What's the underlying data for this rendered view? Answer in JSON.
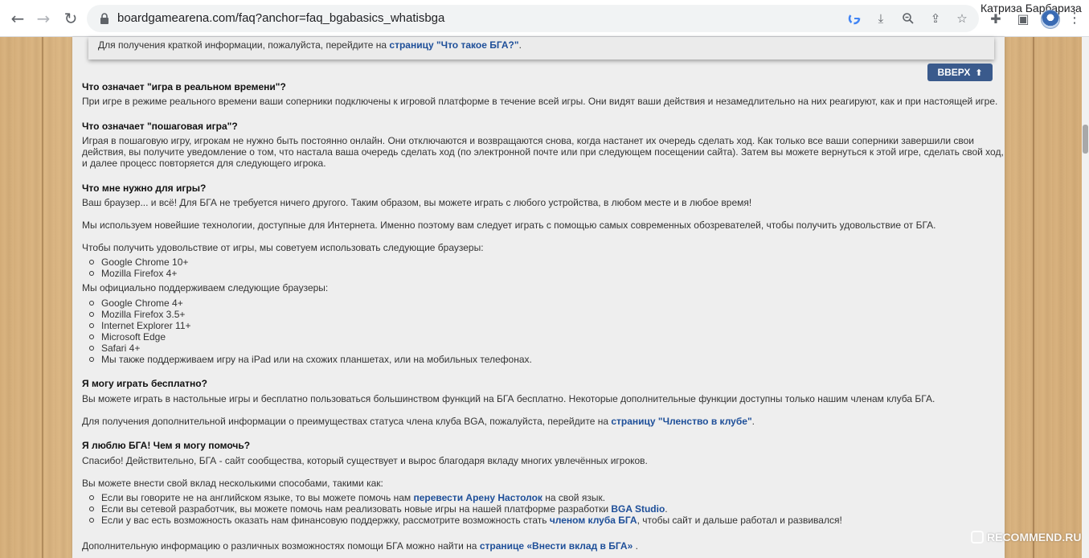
{
  "browser": {
    "url": "boardgamearena.com/faq?anchor=faq_bgabasics_whatisbga",
    "profile_name": "Катриза Барбариза"
  },
  "info": {
    "text": "Для получения краткой информации, пожалуйста, перейдите на ",
    "link": "страницу \"Что такое БГА?\"",
    "tail": "."
  },
  "top_button": "ВВЕРХ",
  "faq": {
    "q1": "Что означает \"игра в реальном времени\"?",
    "a1": "При игре в режиме реального времени ваши соперники подключены к игровой платформе в течение всей игры. Они видят ваши действия и незамедлительно на них реагируют, как и при настоящей игре.",
    "q2": "Что означает \"пошаговая игра\"?",
    "a2_l1": "Играя в пошаговую игру, игрокам не нужно быть постоянно онлайн. Они отключаются и возвращаются снова, когда настанет их очередь сделать ход. Как только все ваши соперники завершили свои",
    "a2_l2": "действия, вы получите уведомление о том, что настала ваша очередь сделать ход (по электронной почте или при следующем посещении сайта). Затем вы можете вернуться к этой игре, сделать свой ход,",
    "a2_l3": "и далее процесс повторяется для следующего игрока.",
    "q3": "Что мне нужно для игры?",
    "a3_p1": "Ваш браузер... и всё! Для БГА не требуется ничего другого. Таким образом, вы можете играть с любого устройства, в любом месте и в любое время!",
    "a3_p2": "Мы используем новейшие технологии, доступные для Интернета. Именно поэтому вам следует играть с помощью самых современных обозревателей, чтобы получить удовольствие от БГА.",
    "a3_p3": "Чтобы получить удовольствие от игры, мы советуем использовать следующие браузеры:",
    "recommended": [
      "Google Chrome 10+",
      "Mozilla Firefox 4+"
    ],
    "a3_p4": "Мы официально поддерживаем следующие браузеры:",
    "supported": [
      "Google Chrome 4+",
      "Mozilla Firefox 3.5+",
      "Internet Explorer 11+",
      "Microsoft Edge",
      "Safari 4+",
      "Мы также поддерживаем игру на iPad или на схожих планшетах, или на мобильных телефонах."
    ],
    "q4": "Я могу играть бесплатно?",
    "a4_p1": "Вы можете играть в настольные игры и бесплатно пользоваться большинством функций на БГА бесплатно. Некоторые дополнительные функции доступны только нашим членам клуба БГА.",
    "a4_p2_text": "Для получения дополнительной информации о преимуществах статуса члена клуба BGA, пожалуйста, перейдите на ",
    "a4_p2_link": "страницу \"Членство в клубе\"",
    "a4_p2_tail": ".",
    "q5": "Я люблю БГА! Чем я могу помочь?",
    "a5_p1": "Спасибо! Действительно, БГА - сайт сообщества, который существует и вырос благодаря вкладу многих увлечённых игроков.",
    "a5_p2": "Вы можете внести свой вклад несколькими способами, такими как:",
    "help1_text": "Если вы говорите не на английском языке, то вы можете помочь нам ",
    "help1_link": "перевести Арену Настолок",
    "help1_tail": " на свой язык.",
    "help2_text": "Если вы сетевой разработчик, вы можете помочь нам реализовать новые игры на нашей платформе разработки ",
    "help2_link": "BGA Studio",
    "help2_tail": ".",
    "help3_text": "Если у вас есть возможность оказать нам финансовую поддержку, рассмотрите возможность стать ",
    "help3_link": "членом клуба БГА",
    "help3_tail": ", чтобы сайт и дальше работал и развивался!",
    "a5_p3_text": "Дополнительную информацию о различных возможностях помощи БГА можно найти на ",
    "a5_p3_link": "странице «Внести вклад в БГА»",
    "a5_p3_tail": " ."
  },
  "watermark": "RECOMMEND.RU"
}
